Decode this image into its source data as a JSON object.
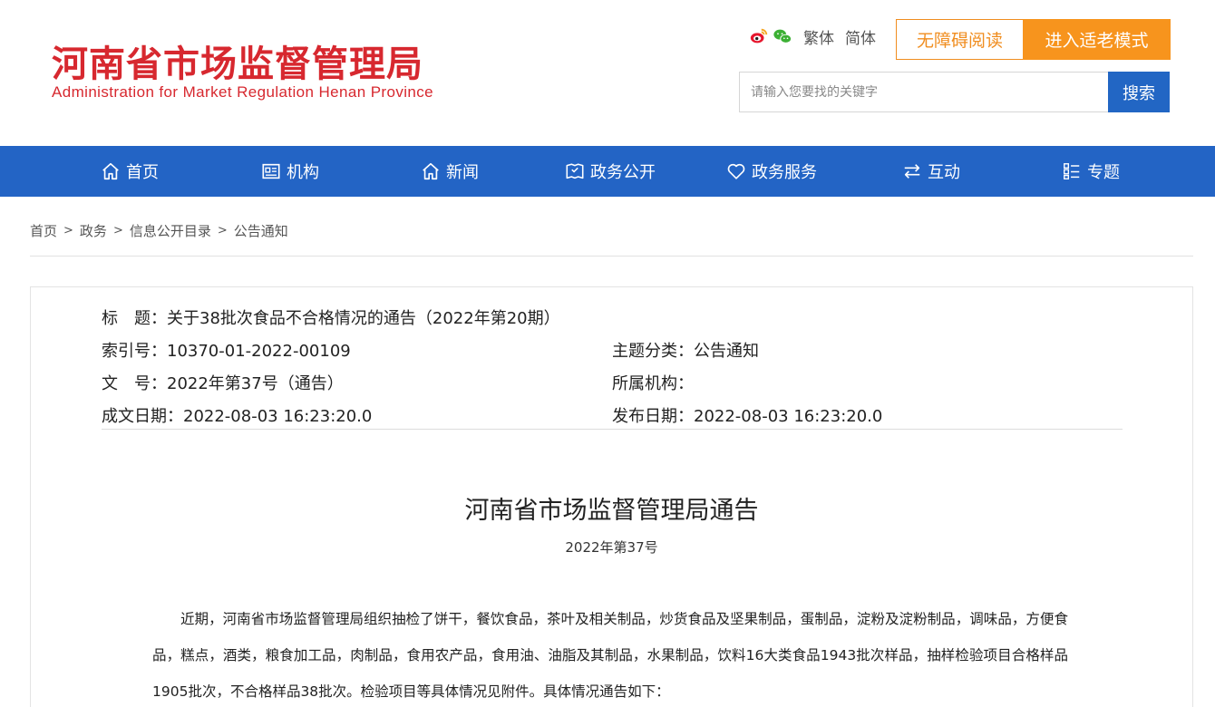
{
  "header": {
    "logo_cn": "河南省市场监督管理局",
    "logo_en": "Administration for Market Regulation Henan Province",
    "social": [
      {
        "icon": "weibo-icon"
      },
      {
        "icon": "wechat-icon"
      }
    ],
    "lang_traditional": "繁体",
    "lang_simplified": "简体",
    "accessible_label": "无障碍阅读",
    "elder_mode_label": "进入适老模式",
    "search_placeholder": "请输入您要找的关键字",
    "search_label": "搜索"
  },
  "nav": {
    "items": [
      {
        "label": "首页",
        "icon": "home-icon"
      },
      {
        "label": "机构",
        "icon": "org-icon"
      },
      {
        "label": "新闻",
        "icon": "news-icon"
      },
      {
        "label": "政务公开",
        "icon": "open-affairs-icon"
      },
      {
        "label": "政务服务",
        "icon": "service-icon"
      },
      {
        "label": "互动",
        "icon": "interact-icon"
      },
      {
        "label": "专题",
        "icon": "topic-icon"
      }
    ]
  },
  "breadcrumb": {
    "items": [
      "首页",
      "政务",
      "信息公开目录",
      "公告通知"
    ],
    "separator": ">"
  },
  "meta": {
    "title": "标　题：关于38批次食品不合格情况的通告（2022年第20期）",
    "index_no": "索引号：10370-01-2022-00109",
    "topic": "主题分类：公告通知",
    "doc_no": "文　号：2022年第37号（通告）",
    "org": "所属机构：",
    "created": "成文日期：2022-08-03 16:23:20.0",
    "published": "发布日期：2022-08-03 16:23:20.0"
  },
  "doc": {
    "title": "河南省市场监督管理局通告",
    "number": "2022年第37号",
    "paragraph": "近期，河南省市场监督管理局组织抽检了饼干，餐饮食品，茶叶及相关制品，炒货食品及坚果制品，蛋制品，淀粉及淀粉制品，调味品，方便食品，糕点，酒类，粮食加工品，肉制品，食用农产品，食用油、油脂及其制品，水果制品，饮料16大类食品1943批次样品，抽样检验项目合格样品1905批次，不合格样品38批次。检验项目等具体情况见附件。具体情况通告如下："
  },
  "colors": {
    "brand_red": "#d7282f",
    "nav_blue": "#2364c5",
    "accent_orange": "#f7941d",
    "search_blue": "#2266c4"
  }
}
